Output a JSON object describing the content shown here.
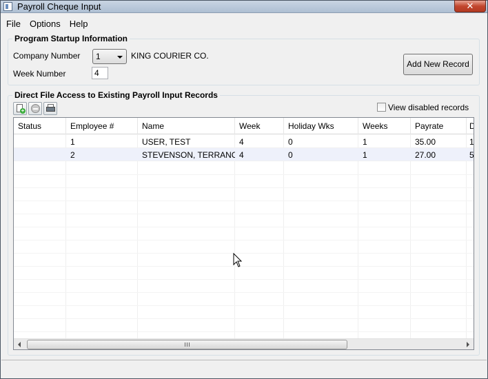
{
  "window": {
    "title": "Payroll Cheque Input",
    "close_label": "✕"
  },
  "menu": {
    "items": [
      "File",
      "Options",
      "Help"
    ]
  },
  "startup": {
    "title": "Program Startup Information",
    "company_label": "Company Number",
    "company_value": "1",
    "company_name": "KING COURIER CO.",
    "week_label": "Week Number",
    "week_value": "4",
    "add_button": "Add New Record"
  },
  "records": {
    "title": "Direct File Access to Existing Payroll Input Records",
    "view_disabled_label": "View disabled records",
    "view_disabled_checked": false,
    "columns": [
      "Status",
      "Employee #",
      "Name",
      "Week",
      "Holiday Wks",
      "Weeks",
      "Payrate",
      "D"
    ],
    "rows": [
      {
        "status": "",
        "employee": "1",
        "name": "USER, TEST",
        "week": "4",
        "holiday": "0",
        "weeks": "1",
        "payrate": "35.00",
        "d": "1"
      },
      {
        "status": "",
        "employee": "2",
        "name": "STEVENSON, TERRANCE",
        "week": "4",
        "holiday": "0",
        "weeks": "1",
        "payrate": "27.00",
        "d": "5"
      }
    ]
  }
}
